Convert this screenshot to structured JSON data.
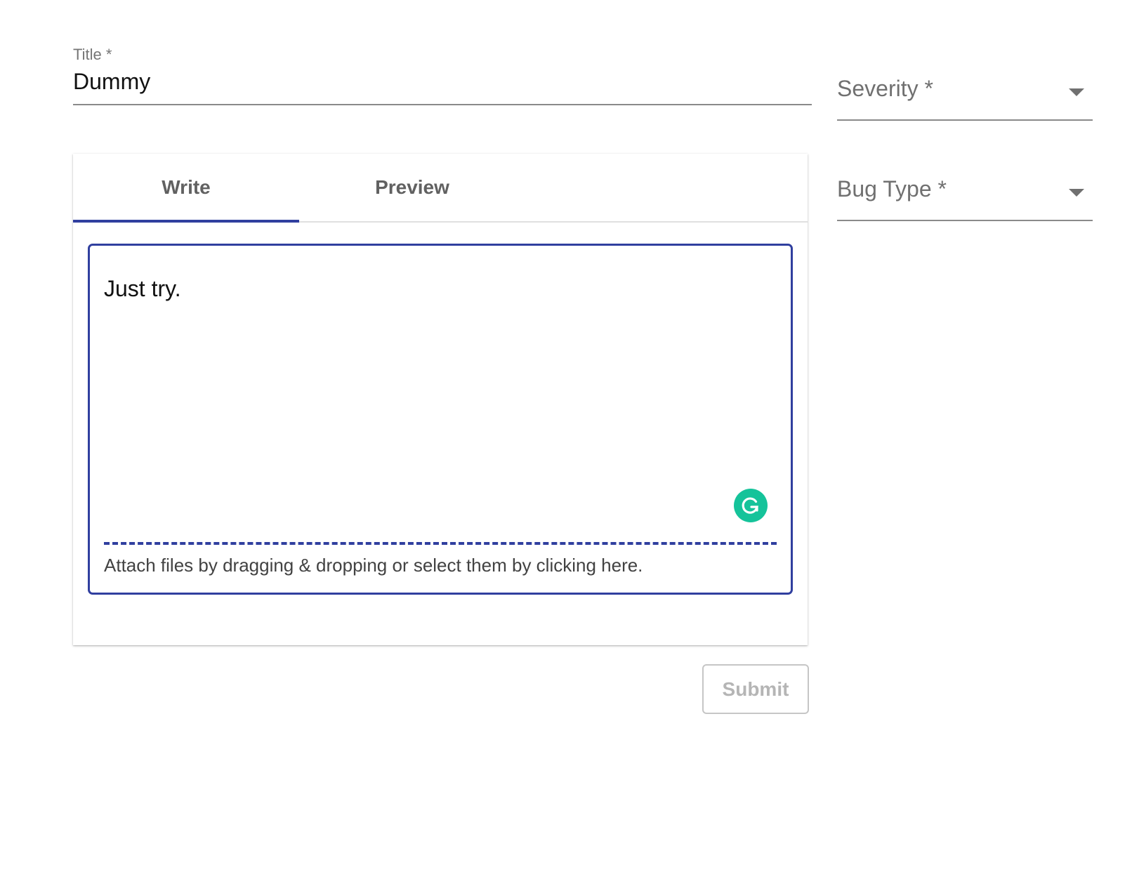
{
  "title_field": {
    "label": "Title *",
    "value": "Dummy"
  },
  "severity_select": {
    "label": "Severity *",
    "icon": "caret-down-icon"
  },
  "bug_type_select": {
    "label": "Bug Type *",
    "icon": "caret-down-icon"
  },
  "editor": {
    "tabs": [
      {
        "label": "Write",
        "active": true
      },
      {
        "label": "Preview",
        "active": false
      }
    ],
    "content": "Just try.",
    "attach_text": "Attach files by dragging & dropping or select them by clicking here.",
    "grammarly_icon": "grammarly-icon"
  },
  "submit": {
    "label": "Submit"
  },
  "colors": {
    "accent": "#303f9f",
    "grammarly": "#15c39a"
  }
}
